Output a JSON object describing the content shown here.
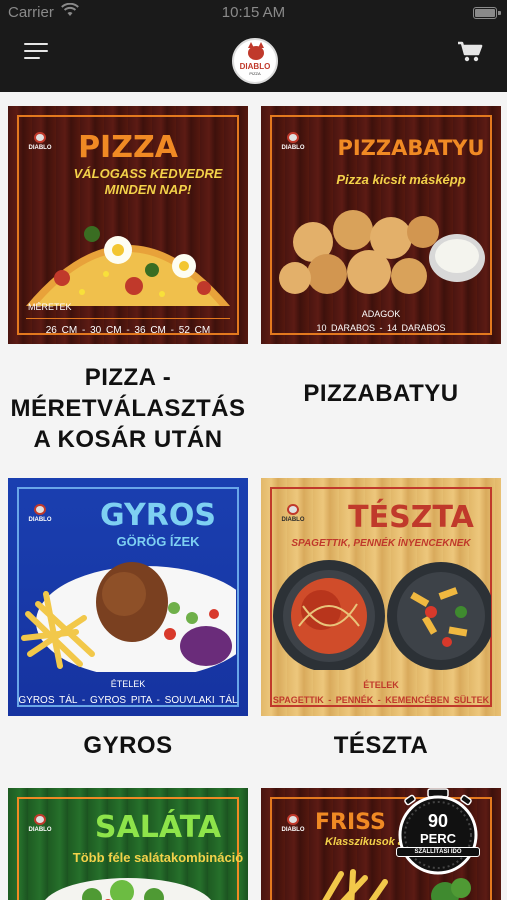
{
  "status": {
    "carrier": "Carrier",
    "time": "10:15 AM"
  },
  "brand": {
    "name": "DIABLO",
    "sub": "PIZZA"
  },
  "icons": {
    "menu": "hamburger-menu-icon",
    "cart": "shopping-cart-icon",
    "wifi": "wifi-icon",
    "battery": "battery-icon"
  },
  "colors": {
    "accent": "#e3791e",
    "brand_red": "#c0392b",
    "navbar": "#1a1a1a"
  },
  "categories": [
    {
      "title": "PIZZA - MÉRETVÁLASZTÁS A KOSÁR UTÁN",
      "headline": "PIZZA",
      "tagline": "VÁLOGASS KEDVEDRE MINDEN NAP!",
      "label": "MÉRETEK",
      "options": "26 CM - 30 CM - 36 CM - 52 CM"
    },
    {
      "title": "PIZZABATYU",
      "headline": "PIZZABATYU",
      "tagline": "Pizza kicsit másképp",
      "label": "ADAGOK",
      "options": "10 DARABOS - 14 DARABOS"
    },
    {
      "title": "GYROS",
      "headline": "GYROS",
      "tagline": "GÖRÖG ÍZEK",
      "label": "ÉTELEK",
      "options": "GYROS TÁL - GYROS PITA - SOUVLAKI TÁL"
    },
    {
      "title": "TÉSZTA",
      "headline": "TÉSZTA",
      "tagline": "SPAGETTIK, PENNÉK ÍNYENCEKNEK",
      "label": "ÉTELEK",
      "options": "SPAGETTIK - PENNÉK - KEMENCÉBEN SÜLTEK"
    },
    {
      "headline": "SALÁTA",
      "tagline": "Több féle salátakombináció"
    },
    {
      "headline": "FRISS",
      "tagline": "Klasszikusok a"
    }
  ],
  "delivery_badge": {
    "number": "90",
    "unit": "PERC",
    "caption": "SZÁLLÍTÁSI IDŐ"
  }
}
